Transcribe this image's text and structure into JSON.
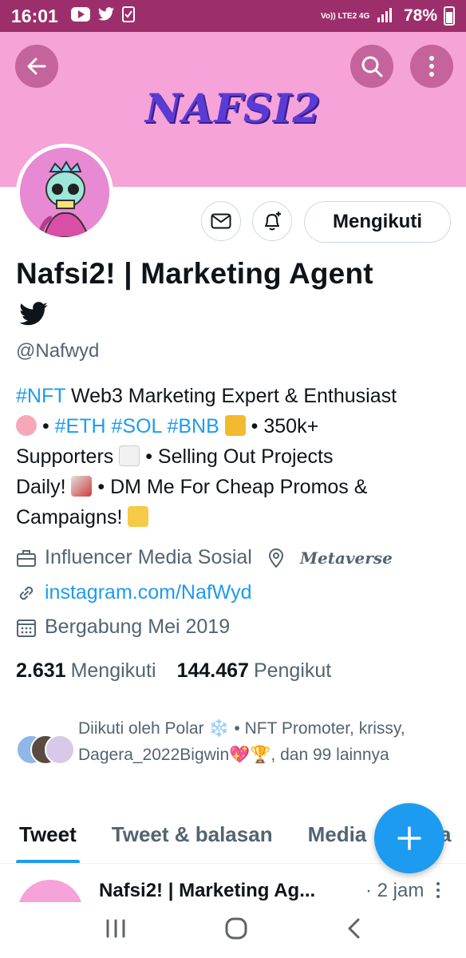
{
  "status_bar": {
    "time": "16:01",
    "network": "Vo)) LTE2 4G",
    "battery": "78%"
  },
  "banner": {
    "logo_text": "NAFSI2",
    "bg_color": "#f5a3d8"
  },
  "profile": {
    "follow_button": "Mengikuti",
    "name": "Nafsi2! | Marketing Agent",
    "handle": "@Nafwyd",
    "bio": {
      "line1_tag": "#NFT",
      "line1_text": " Web3 Marketing Expert & Enthusiast",
      "line2_tags": "#ETH #SOL #BNB",
      "line2_sep": " • ",
      "line2_text": " • 350k+",
      "line3_text": "Supporters ",
      "line3_rest": " • Selling Out Projects",
      "line4_text": "Daily! ",
      "line4_rest": " • DM Me For Cheap Promos &",
      "line5_text": "Campaigns! "
    },
    "category": "Influencer Media Sosial",
    "location": "Metaverse",
    "link": "instagram.com/NafWyd",
    "joined": "Bergabung Mei 2019",
    "following_count": "2.631",
    "following_label": "Mengikuti",
    "followers_count": "144.467",
    "followers_label": "Pengikut",
    "followed_by": "Diikuti oleh Polar ❄️ • NFT Promoter, krissy, Dagera_2022Bigwin💖🏆, dan 99 lainnya"
  },
  "tabs": [
    {
      "label": "Tweet"
    },
    {
      "label": "Tweet & balasan"
    },
    {
      "label": "Media"
    },
    {
      "label": "Suka"
    }
  ],
  "tweet_preview": {
    "name": "Nafsi2! | Marketing Ag...",
    "time": "· 2 jam"
  },
  "colors": {
    "accent": "#1d9bf0",
    "status_bar": "#9c2f6b"
  }
}
